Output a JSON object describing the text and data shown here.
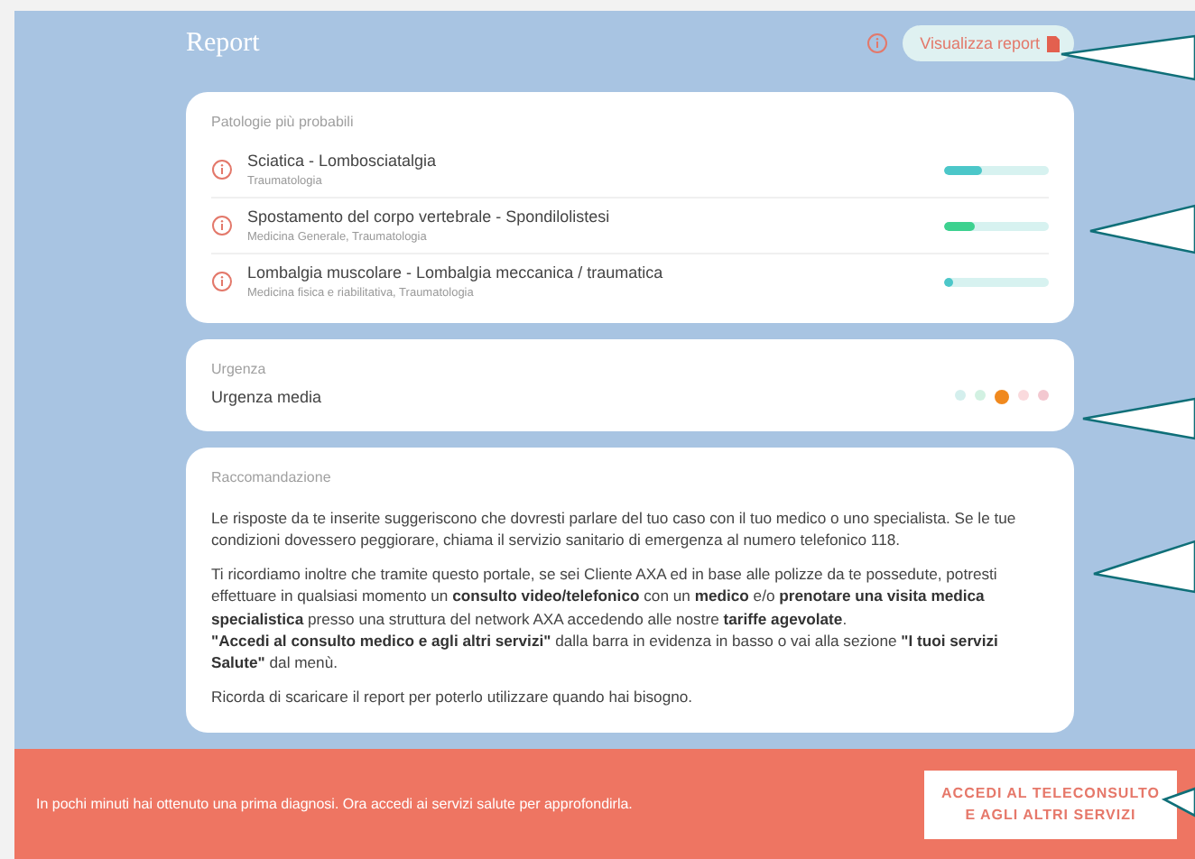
{
  "header": {
    "title": "Report",
    "report_button": "Visualizza report"
  },
  "pathologies": {
    "heading": "Patologie più probabili",
    "items": [
      {
        "name": "Sciatica - Lombosciatalgia",
        "specialty": "Traumatologia",
        "level": 0.37,
        "color": "#4cc7c9"
      },
      {
        "name": "Spostamento del corpo vertebrale - Spondilolistesi",
        "specialty": "Medicina Generale, Traumatologia",
        "level": 0.3,
        "color": "#3dd18f"
      },
      {
        "name": "Lombalgia muscolare - Lombalgia meccanica / traumatica",
        "specialty": "Medicina fisica e riabilitativa, Traumatologia",
        "level": 0.08,
        "color": "#4cc7c9"
      }
    ]
  },
  "urgency": {
    "heading": "Urgenza",
    "label": "Urgenza media",
    "dots": [
      {
        "color": "#d4efed",
        "selected": false
      },
      {
        "color": "#d2f1e2",
        "selected": false
      },
      {
        "color": "#f0891e",
        "selected": true
      },
      {
        "color": "#fadadd",
        "selected": false
      },
      {
        "color": "#f3c8d0",
        "selected": false
      }
    ]
  },
  "recommendation": {
    "heading": "Raccomandazione",
    "paragraphs": [
      [
        "Le risposte da te inserite suggeriscono che dovresti parlare del tuo caso con il tuo medico o uno specialista. Se le tue condizioni dovessero peggiorare, chiama il servizio sanitario di emergenza al numero telefonico 118."
      ],
      [
        "Ti ricordiamo inoltre che tramite questo portale, se sei Cliente AXA ed in base alle polizze da te possedute, potresti effettuare in qualsiasi momento un **consulto video/telefonico** con un **medico** e/o **prenotare una visita medica specialistica** presso una struttura del network AXA accedendo alle nostre **tariffe agevolate**.",
        "**\"Accedi al consulto medico e agli altri servizi\"** dalla barra in evidenza in basso o vai alla sezione **\"I tuoi servizi Salute\"** dal menù."
      ],
      [
        "Ricorda di scaricare il report per poterlo utilizzare quando hai bisogno."
      ]
    ]
  },
  "bottom_bar": {
    "message": "In pochi minuti hai ottenuto una prima diagnosi. Ora accedi ai servizi salute per approfondirla.",
    "button": [
      "ACCEDI AL TELECONSULTO",
      "E AGLI ALTRI SERVIZI"
    ]
  }
}
